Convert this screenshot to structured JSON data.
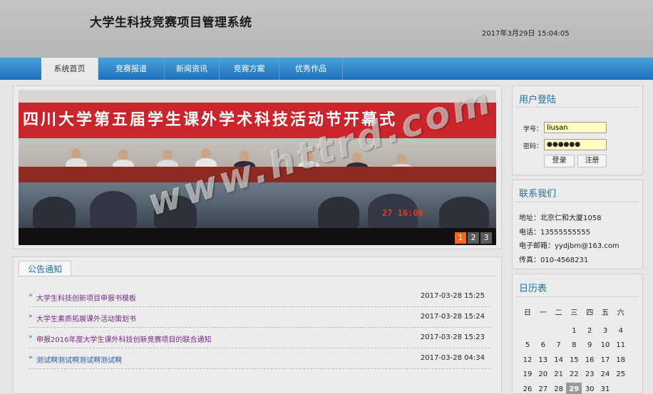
{
  "header": {
    "site_title": "大学生科技竞赛项目管理系统",
    "datetime": "2017年3月29日 15:04:05"
  },
  "nav": {
    "items": [
      "系统首页",
      "竞赛报道",
      "新闻资讯",
      "竞赛方案",
      "优秀作品"
    ],
    "active": "系统首页"
  },
  "slider": {
    "banner_text": "四川大学第五届学生课外学术科技活动节开幕式",
    "timestamp": "27 16:08",
    "pages": [
      "1",
      "2",
      "3"
    ],
    "active_page": "1"
  },
  "watermark": "www.httrd.com",
  "notices": {
    "tab_label": "公告通知",
    "items": [
      {
        "title": "大学生科技创新项目申报书模板",
        "date": "2017-03-28 15:25"
      },
      {
        "title": "大学生素质拓展课外活动策划书",
        "date": "2017-03-28 15:24"
      },
      {
        "title": "申报2016年度大学生课外科技创新竞赛项目的联合通知",
        "date": "2017-03-28 15:23"
      },
      {
        "title": "测试啊测试啊测试啊测试啊",
        "date": "2017-03-28 04:34"
      }
    ]
  },
  "login": {
    "title": "用户登陆",
    "username_label": "学号：",
    "username_value": "liusan",
    "password_label": "密码：",
    "password_value": "●●●●●●",
    "login_button": "登录",
    "register_button": "注册"
  },
  "contact": {
    "title": "联系我们",
    "address": "地址：北京仁和大厦1058",
    "phone": "电话：13555555555",
    "email": "电子邮箱：yydjbm@163.com",
    "fax": "传真：010-4568231"
  },
  "calendar": {
    "title": "日历表",
    "weekdays": [
      "日",
      "一",
      "二",
      "三",
      "四",
      "五",
      "六"
    ],
    "rows": [
      [
        "",
        "",
        "",
        "1",
        "2",
        "3",
        "4"
      ],
      [
        "5",
        "6",
        "7",
        "8",
        "9",
        "10",
        "11"
      ],
      [
        "12",
        "13",
        "14",
        "15",
        "16",
        "17",
        "18"
      ],
      [
        "19",
        "20",
        "21",
        "22",
        "23",
        "24",
        "25"
      ],
      [
        "26",
        "27",
        "28",
        "29",
        "30",
        "31",
        ""
      ]
    ],
    "today": "29"
  },
  "colors": {
    "nav_blue": "#1f72b8",
    "link_purple": "#7a2a8a",
    "accent_blue": "#1d6fa8",
    "pager_active": "#f06a1a"
  }
}
